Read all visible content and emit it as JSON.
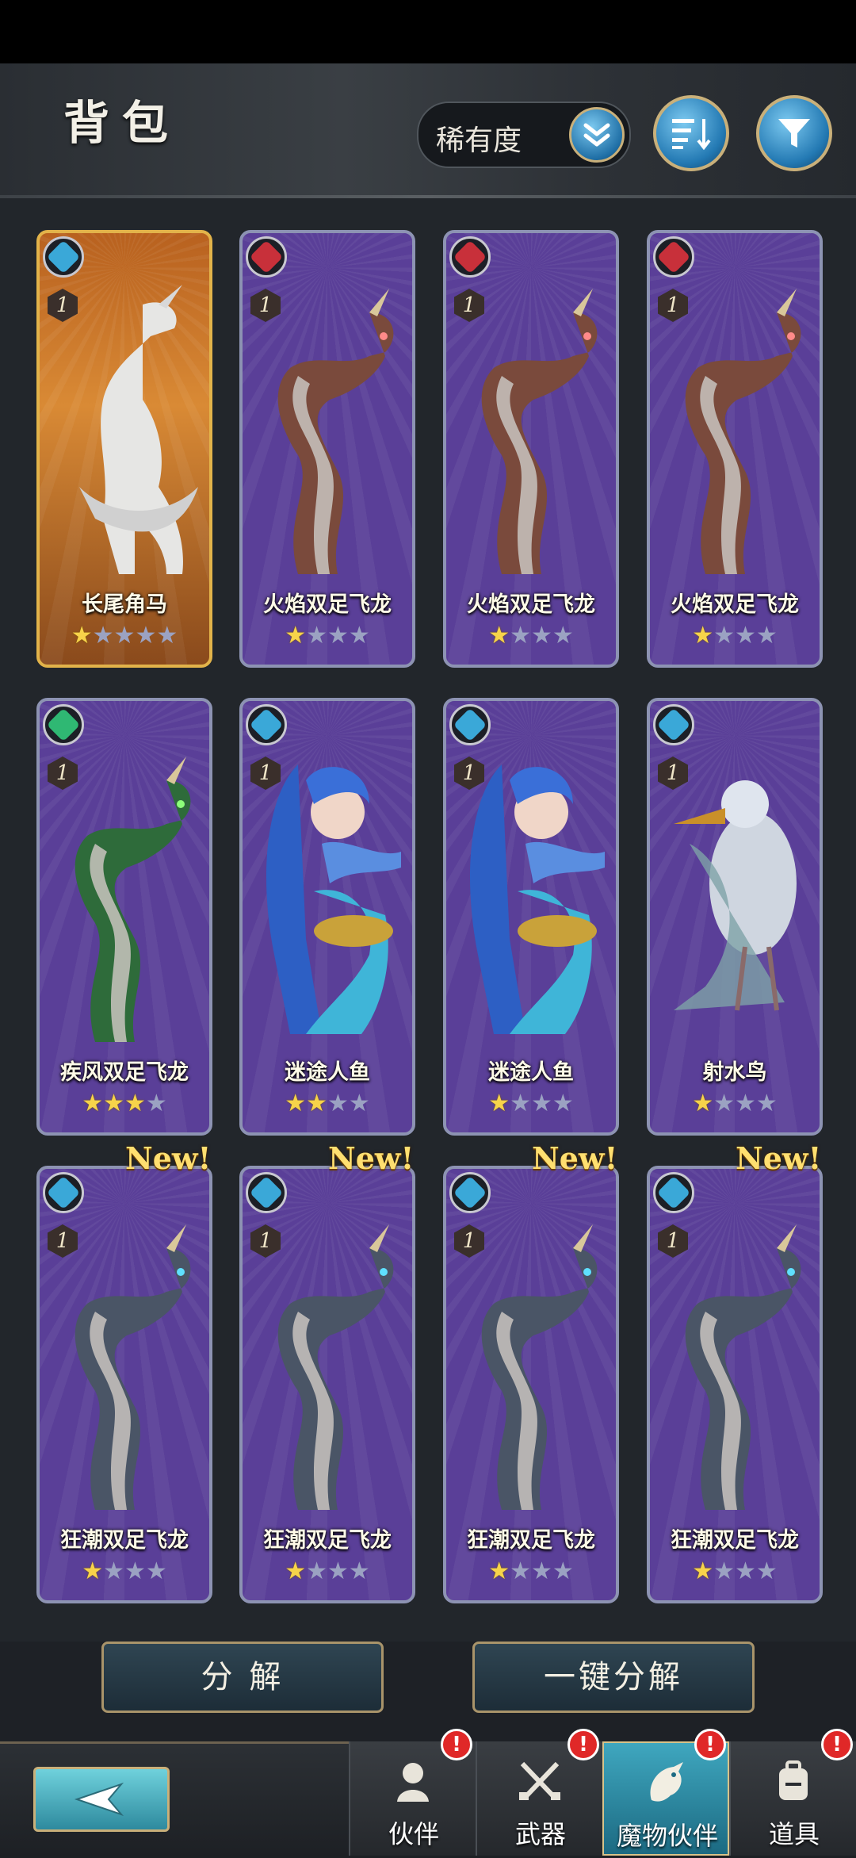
{
  "header": {
    "title": "背包",
    "sort_label": "稀有度"
  },
  "cards": [
    {
      "name": "长尾角马",
      "level": "1",
      "stars": 1,
      "max_stars": 5,
      "frame": "gold",
      "element": "water",
      "new": false
    },
    {
      "name": "火焰双足飞龙",
      "level": "1",
      "stars": 1,
      "max_stars": 4,
      "frame": "purple",
      "element": "fire",
      "new": false
    },
    {
      "name": "火焰双足飞龙",
      "level": "1",
      "stars": 1,
      "max_stars": 4,
      "frame": "purple",
      "element": "fire",
      "new": false
    },
    {
      "name": "火焰双足飞龙",
      "level": "1",
      "stars": 1,
      "max_stars": 4,
      "frame": "purple",
      "element": "fire",
      "new": false
    },
    {
      "name": "疾风双足飞龙",
      "level": "1",
      "stars": 3,
      "max_stars": 4,
      "frame": "purple",
      "element": "wind",
      "new": false
    },
    {
      "name": "迷途人鱼",
      "level": "1",
      "stars": 2,
      "max_stars": 4,
      "frame": "purple",
      "element": "water",
      "new": false
    },
    {
      "name": "迷途人鱼",
      "level": "1",
      "stars": 1,
      "max_stars": 4,
      "frame": "purple",
      "element": "water",
      "new": false
    },
    {
      "name": "射水鸟",
      "level": "1",
      "stars": 1,
      "max_stars": 4,
      "frame": "purple",
      "element": "water",
      "new": false
    },
    {
      "name": "狂潮双足飞龙",
      "level": "1",
      "stars": 1,
      "max_stars": 4,
      "frame": "purple",
      "element": "water",
      "new": true
    },
    {
      "name": "狂潮双足飞龙",
      "level": "1",
      "stars": 1,
      "max_stars": 4,
      "frame": "purple",
      "element": "water",
      "new": true
    },
    {
      "name": "狂潮双足飞龙",
      "level": "1",
      "stars": 1,
      "max_stars": 4,
      "frame": "purple",
      "element": "water",
      "new": true
    },
    {
      "name": "狂潮双足飞龙",
      "level": "1",
      "stars": 1,
      "max_stars": 4,
      "frame": "purple",
      "element": "water",
      "new": true
    }
  ],
  "new_label": "New!",
  "actions": {
    "decompose": "分 解",
    "one_click_decompose": "一键分解"
  },
  "tabs": [
    {
      "label": "伙伴",
      "icon": "partner-icon",
      "badge": "!"
    },
    {
      "label": "武器",
      "icon": "weapon-icon",
      "badge": "!"
    },
    {
      "label": "魔物伙伴",
      "icon": "monster-icon",
      "badge": "!",
      "active": true
    },
    {
      "label": "道具",
      "icon": "backpack-icon",
      "badge": "!"
    }
  ],
  "colors": {
    "fire": "#c8303a",
    "water": "#3aa8d8",
    "wind": "#2fb873",
    "purple_card": "#5a3f98",
    "gold_card": "#d98a35"
  }
}
